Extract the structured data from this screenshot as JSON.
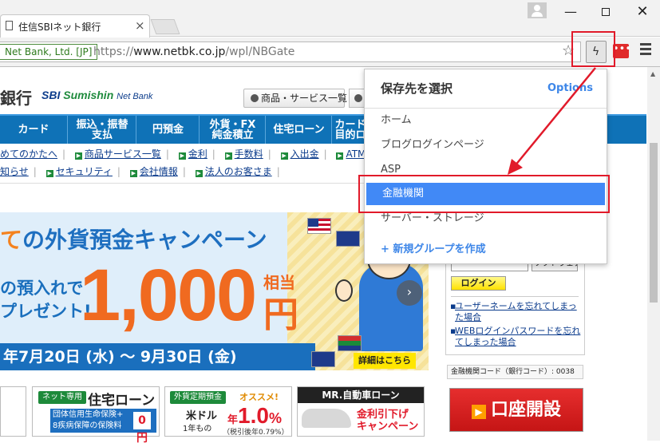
{
  "browser": {
    "tab_title": "住信SBIネット銀行",
    "tab_close": "×",
    "window_min": "—",
    "window_close": "✕",
    "ev_badge": "Net Bank, Ltd. [JP]",
    "url_scheme": "https://",
    "url_host": "www.netbk.co.jp",
    "url_path": "/wpl/NBGate",
    "star": "☆",
    "ext_icon": "ϟ",
    "red_ext_icon": "•••"
  },
  "site": {
    "logo_jp": "銀行",
    "logo_sbi": "SBI",
    "logo_sumishin": "Sumishin",
    "logo_netbank": "Net Bank",
    "product_list": "商品・サービス一覧",
    "nav": [
      {
        "label": "カード"
      },
      {
        "label": "振込・振替\n支払"
      },
      {
        "label": "円預金"
      },
      {
        "label": "外貨・FX\n純金積立"
      },
      {
        "label": "住宅ローン"
      },
      {
        "label": "カード\n目的ロ"
      }
    ],
    "links_row1": [
      "めてのかたへ",
      "商品サービス一覧",
      "金利",
      "手数料",
      "入出金",
      "ATM"
    ],
    "links_row2": [
      "知らせ",
      "セキュリティ",
      "会社情報",
      "法人のお客さま"
    ]
  },
  "banner": {
    "title_accent": "て",
    "title": "の外貨預金キャンペーン",
    "sub1": "の預入れで",
    "sub2": "プレゼント!",
    "amount": "1,000",
    "unit_top": "相当",
    "unit": "円",
    "date_range": "年7月20日 (水) ～ 9月30日 (金)",
    "detail_button": "詳細はこちら",
    "next_arrow": "›"
  },
  "login": {
    "softkey": "ソフトウェアキーボード",
    "login_button": "ログイン",
    "help1": "ユーザーネームを忘れてしまった場合",
    "help2": "WEBログインパスワードを忘れてしまった場合",
    "bank_code": "金融機関コード（銀行コード）: 0038",
    "open_account": "口座開設"
  },
  "promos": {
    "tile1": {
      "tag": "ネット専用",
      "title": "住宅ローン",
      "box_line1": "団体信用生命保険+",
      "box_line2": "8疾病保障の保険料",
      "zero": "0円"
    },
    "tile2": {
      "tag": "外貨定期預金",
      "recommend": "オススメ!",
      "currency": "米ドル",
      "term": "1年もの",
      "rate_prefix": "年",
      "rate": "1.0",
      "rate_unit": "%",
      "note": "（税引後年0.79%）"
    },
    "tile3": {
      "head": "MR.自動車ローン",
      "discount1": "金利引下げ",
      "discount2": "キャンペーン"
    }
  },
  "popup": {
    "title": "保存先を選択",
    "options_link": "Options",
    "items": [
      "ホーム",
      "ブログログインページ",
      "ASP",
      "金融機関",
      "サーバー・ストレージ"
    ],
    "selected_index": 3,
    "new_group": "+ 新規グループを作成"
  },
  "colors": {
    "accent_red": "#e11a2a",
    "selection_blue": "#4189f6",
    "nav_blue": "#0f72b7"
  }
}
